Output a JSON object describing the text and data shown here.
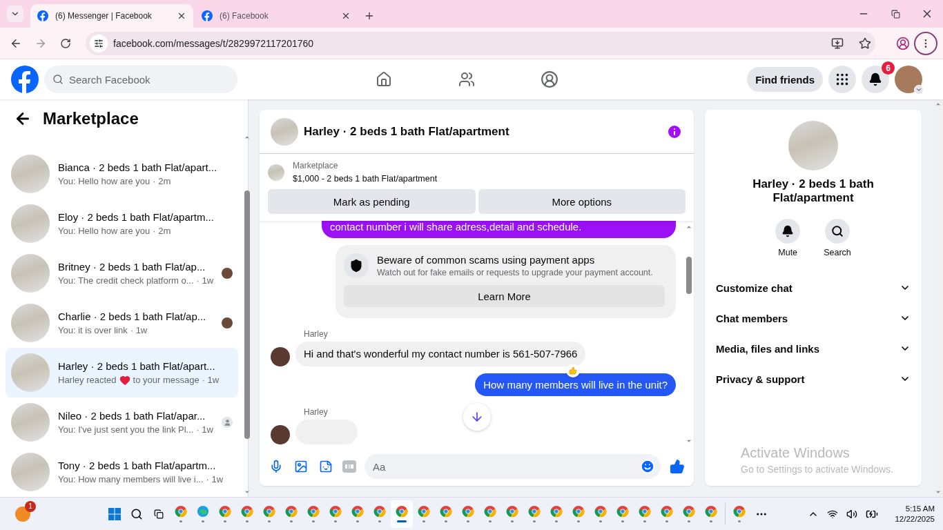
{
  "browser": {
    "tabs": [
      {
        "title": "(6) Messenger | Facebook",
        "selected": true
      },
      {
        "title": "(6) Facebook",
        "selected": false
      }
    ],
    "url": "facebook.com/messages/t/2829972117201760"
  },
  "header": {
    "search_placeholder": "Search Facebook",
    "find_friends": "Find friends",
    "notification_count": "6"
  },
  "sidebar": {
    "title": "Marketplace",
    "conversations": [
      {
        "name": "Bianca · 2 beds 1 bath Flat/apart...",
        "kind": "text",
        "preview": "You: Hello how are you",
        "time": "· 2m",
        "selected": false
      },
      {
        "name": "Eloy · 2 beds 1 bath Flat/apartm...",
        "kind": "text",
        "preview": "You: Hello how are you",
        "time": "· 2m",
        "selected": false
      },
      {
        "name": "Britney · 2 beds 1 bath Flat/ap...",
        "kind": "text",
        "preview": "You: The credit check platform o...",
        "time": "· 1w",
        "selected": false,
        "receipt": {
          "kind": "photo"
        }
      },
      {
        "name": "Charlie · 2 beds 1 bath Flat/ap...",
        "kind": "text",
        "preview": "You: it is over link",
        "time": "· 1w",
        "selected": false,
        "receipt": {
          "kind": "photo"
        }
      },
      {
        "name": "Harley · 2 beds 1 bath Flat/apart...",
        "kind": "reaction",
        "preview": "Harley reacted",
        "preview_end": "to your message",
        "time": "· 1w",
        "selected": true
      },
      {
        "name": "Nileo · 2 beds 1 bath Flat/apar...",
        "kind": "text",
        "preview": "You: I've just sent you the link Pl...",
        "time": "· 1w",
        "selected": false,
        "receipt": {
          "kind": "generic"
        }
      },
      {
        "name": "Tony · 2 beds 1 bath Flat/apartm...",
        "kind": "text",
        "preview": "You: How many members will live i...",
        "time": "· 1w",
        "selected": false
      }
    ]
  },
  "chat": {
    "title": "Harley · 2 beds 1 bath Flat/apartment",
    "listing": {
      "label": "Marketplace",
      "title": "$1,000 - 2 beds 1 bath Flat/apartment",
      "buttons": [
        "Mark as pending",
        "More options"
      ]
    },
    "messages": [
      {
        "kind": "outgoing",
        "color": "#9b10f5",
        "text": "contact number i will share adress,detail and schedule."
      },
      {
        "kind": "notice",
        "title": "Beware of common scams using payment apps",
        "text": "Watch out for fake emails or requests to upgrade your payment account.",
        "button": "Learn More"
      },
      {
        "kind": "incoming",
        "sender": "Harley",
        "text": "Hi and that's wonderful my contact number is 561-507-7966",
        "reaction": true
      },
      {
        "kind": "outgoing",
        "color": "#2457f5",
        "text": "How many members will live in the unit?"
      },
      {
        "kind": "incoming",
        "sender": "Harley"
      }
    ],
    "composer_placeholder": "Aa"
  },
  "details": {
    "title": "Harley · 2 beds 1 bath Flat/apartment",
    "actions": [
      {
        "kind": "mute",
        "label": "Mute"
      },
      {
        "kind": "search",
        "label": "Search"
      }
    ],
    "sections": [
      {
        "label": "Customize chat",
        "expanded": false
      },
      {
        "label": "Chat members",
        "expanded": false
      },
      {
        "label": "Media, files and links",
        "expanded": false
      },
      {
        "label": "Privacy & support",
        "expanded": false
      }
    ]
  },
  "activation_notice": {
    "title": "Activate Windows",
    "text": "Go to Settings to activate Windows."
  },
  "taskbar": {
    "start_badge": "1",
    "apps": [
      {
        "kind": "chrome",
        "selected": false
      },
      {
        "kind": "edge",
        "selected": false
      },
      {
        "kind": "chrome",
        "selected": false
      },
      {
        "kind": "chrome",
        "selected": false
      },
      {
        "kind": "chrome",
        "selected": false
      },
      {
        "kind": "chrome",
        "selected": false
      },
      {
        "kind": "chrome",
        "selected": false
      },
      {
        "kind": "chrome",
        "selected": false
      },
      {
        "kind": "chrome",
        "selected": false
      },
      {
        "kind": "chrome",
        "selected": false
      },
      {
        "kind": "chrome",
        "selected": true
      },
      {
        "kind": "chrome",
        "selected": false
      },
      {
        "kind": "chrome",
        "selected": false
      },
      {
        "kind": "chrome",
        "selected": false
      },
      {
        "kind": "chrome",
        "selected": false
      },
      {
        "kind": "chrome",
        "selected": false
      },
      {
        "kind": "chrome",
        "selected": false
      },
      {
        "kind": "chrome",
        "selected": false
      },
      {
        "kind": "chrome",
        "selected": false
      },
      {
        "kind": "chrome",
        "selected": false
      },
      {
        "kind": "chrome",
        "selected": false
      },
      {
        "kind": "chrome",
        "selected": false
      },
      {
        "kind": "chrome",
        "selected": false
      },
      {
        "kind": "chrome",
        "selected": false
      },
      {
        "kind": "chrome",
        "selected": false
      }
    ],
    "pinned_after": [
      {
        "kind": "chrome",
        "selected": false
      }
    ],
    "time": "5:15 AM",
    "date": "12/22/2025"
  }
}
